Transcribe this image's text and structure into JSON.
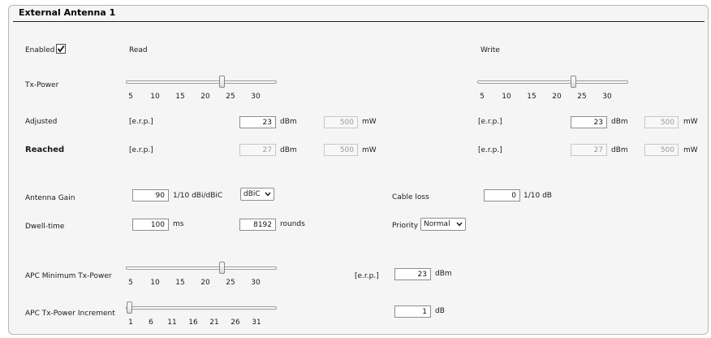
{
  "panel": {
    "title": "External Antenna 1"
  },
  "enabled": {
    "label": "Enabled",
    "checked": true
  },
  "headers": {
    "read": "Read",
    "write": "Write"
  },
  "tx_power": {
    "label": "Tx-Power",
    "ticks": [
      "5",
      "10",
      "15",
      "20",
      "25",
      "30"
    ],
    "read_value": 23,
    "write_value": 23
  },
  "adjusted": {
    "label": "Adjusted",
    "read": {
      "erp": "[e.r.p.]",
      "dbm": "23",
      "dbm_unit": "dBm",
      "mw": "500",
      "mw_unit": "mW"
    },
    "write": {
      "erp": "[e.r.p.]",
      "dbm": "23",
      "dbm_unit": "dBm",
      "mw": "500",
      "mw_unit": "mW"
    }
  },
  "reached": {
    "label": "Reached",
    "read": {
      "erp": "[e.r.p.]",
      "dbm": "27",
      "dbm_unit": "dBm",
      "mw": "500",
      "mw_unit": "mW"
    },
    "write": {
      "erp": "[e.r.p.]",
      "dbm": "27",
      "dbm_unit": "dBm",
      "mw": "500",
      "mw_unit": "mW"
    }
  },
  "antenna_gain": {
    "label": "Antenna Gain",
    "value": "90",
    "unit": "1/10 dBi/dBiC",
    "type_selected": "dBiC"
  },
  "cable_loss": {
    "label": "Cable loss",
    "value": "0",
    "unit": "1/10 dB"
  },
  "dwell_time": {
    "label": "Dwell-time",
    "value": "100",
    "unit": "ms",
    "rounds_value": "8192",
    "rounds_unit": "rounds"
  },
  "priority": {
    "label": "Priority",
    "selected": "Normal"
  },
  "apc_min": {
    "label": "APC Minimum Tx-Power",
    "ticks": [
      "5",
      "10",
      "15",
      "20",
      "25",
      "30"
    ],
    "value": 23,
    "erp": "[e.r.p.]",
    "dbm": "23",
    "dbm_unit": "dBm"
  },
  "apc_inc": {
    "label": "APC Tx-Power Increment",
    "ticks": [
      "1",
      "6",
      "11",
      "16",
      "21",
      "26",
      "31"
    ],
    "value": 1,
    "db": "1",
    "db_unit": "dB"
  }
}
